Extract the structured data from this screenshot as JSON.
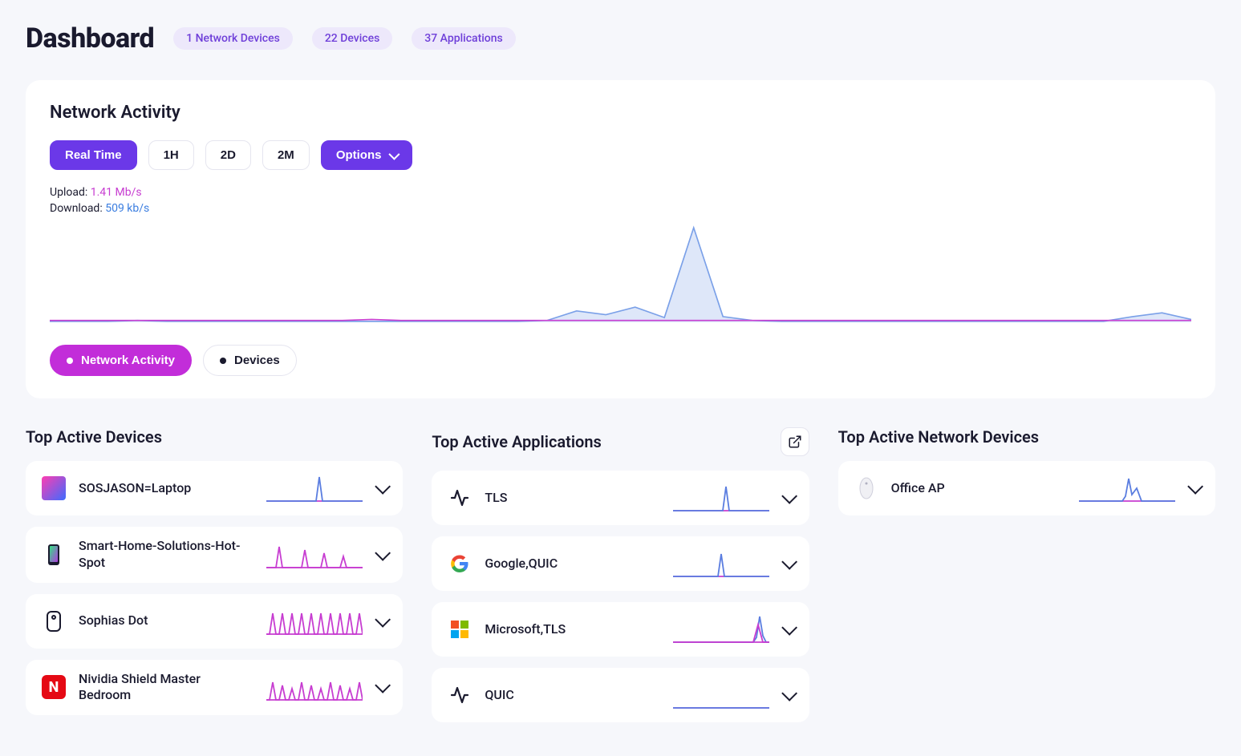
{
  "header": {
    "title": "Dashboard",
    "badges": [
      "1 Network Devices",
      "22 Devices",
      "37 Applications"
    ]
  },
  "network_activity": {
    "title": "Network Activity",
    "time_ranges": [
      "Real Time",
      "1H",
      "2D",
      "2M"
    ],
    "active_range": 0,
    "options_label": "Options",
    "upload_label": "Upload:",
    "upload_value": "1.41 Mb/s",
    "download_label": "Download:",
    "download_value": "509 kb/s",
    "toggles": {
      "network": "Network Activity",
      "devices": "Devices"
    }
  },
  "chart_data": {
    "type": "area",
    "title": "Network Activity",
    "xlabel": "",
    "ylabel": "",
    "x": [
      0,
      1,
      2,
      3,
      4,
      5,
      6,
      7,
      8,
      9,
      10,
      11,
      12,
      13,
      14,
      15,
      16,
      17,
      18,
      19,
      20,
      21,
      22,
      23,
      24,
      25,
      26,
      27,
      28,
      29,
      30,
      31,
      32,
      33,
      34,
      35,
      36,
      37,
      38,
      39
    ],
    "series": [
      {
        "name": "Download",
        "color": "#7aa0e8",
        "values": [
          1,
          1,
          1,
          2,
          1,
          1,
          1,
          1,
          1,
          1,
          1,
          1,
          1,
          1,
          1,
          1,
          1,
          2,
          12,
          8,
          16,
          5,
          100,
          6,
          2,
          1,
          1,
          1,
          1,
          1,
          1,
          1,
          1,
          1,
          1,
          1,
          1,
          6,
          10,
          3
        ]
      },
      {
        "name": "Upload",
        "color": "#c73dd1",
        "values": [
          2,
          2,
          2,
          2,
          2,
          2,
          2,
          2,
          2,
          2,
          2,
          3,
          2,
          2,
          2,
          2,
          2,
          2,
          2,
          2,
          2,
          2,
          2,
          2,
          2,
          2,
          2,
          2,
          2,
          2,
          2,
          2,
          2,
          2,
          2,
          2,
          2,
          2,
          2,
          2
        ]
      }
    ],
    "ylim": [
      0,
      100
    ]
  },
  "columns": {
    "devices": {
      "title": "Top Active Devices",
      "items": [
        {
          "label": "SOSJASON=Laptop",
          "icon": "laptop",
          "spark": "spike-one-blue"
        },
        {
          "label": "Smart-Home-Solutions-Hot-Spot",
          "icon": "phone",
          "spark": "multispike-pink"
        },
        {
          "label": "Sophias Dot",
          "icon": "speaker",
          "spark": "dense-pink"
        },
        {
          "label": "Nividia Shield Master Bedroom",
          "icon": "netflix",
          "spark": "dense-pink-2"
        }
      ]
    },
    "apps": {
      "title": "Top Active Applications",
      "items": [
        {
          "label": "TLS",
          "icon": "activity",
          "spark": "spike-one-blue"
        },
        {
          "label": "Google,QUIC",
          "icon": "google",
          "spark": "spike-one-blue-2"
        },
        {
          "label": "Microsoft,TLS",
          "icon": "microsoft",
          "spark": "spike-end"
        },
        {
          "label": "QUIC",
          "icon": "activity",
          "spark": "flat"
        }
      ]
    },
    "network": {
      "title": "Top Active Network Devices",
      "items": [
        {
          "label": "Office AP",
          "icon": "ap",
          "spark": "spike-mid-blue"
        }
      ]
    }
  }
}
